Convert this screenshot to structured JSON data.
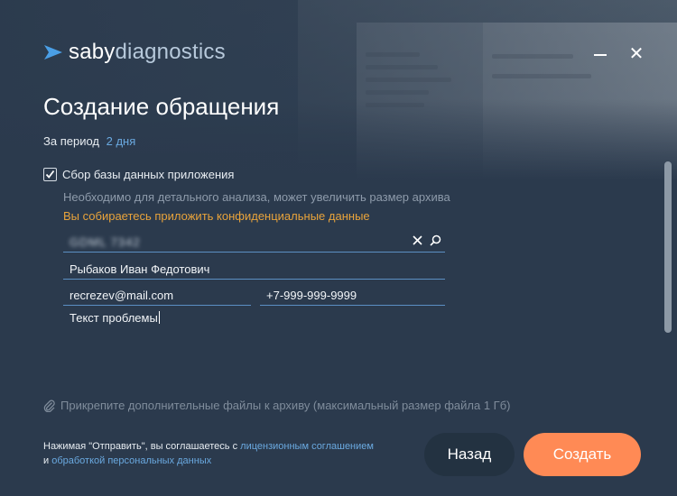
{
  "window": {
    "minimize_label": "minimize",
    "close_label": "✕"
  },
  "logo": {
    "part1": "saby",
    "part2": "diagnostics"
  },
  "title": "Создание обращения",
  "period": {
    "label": "За период",
    "value": "2 дня"
  },
  "collect_db": {
    "checked": true,
    "label": "Сбор базы данных приложения",
    "hint": "Необходимо для детального анализа, может увеличить размер архива",
    "warning": "Вы собираетесь приложить конфиденциальные данные"
  },
  "form": {
    "search_value": "GDML 7342",
    "name_value": "Рыбаков Иван Федотович",
    "email_value": "recrezev@mail.com",
    "phone_value": "+7-999-999-9999",
    "problem_value": "Текст проблемы"
  },
  "attach": {
    "label": "Прикрепите дополнительные файлы к архиву (максимальный размер файла 1 Гб)"
  },
  "agreement": {
    "prefix": "Нажимая \"Отправить\", вы соглашаетесь с ",
    "license_link": "лицензионным соглашением",
    "and": "и ",
    "personal_link": "обработкой персональных данных"
  },
  "buttons": {
    "back": "Назад",
    "create": "Создать"
  },
  "colors": {
    "accent_link": "#6aa9e0",
    "warning": "#e8a33b",
    "primary_button": "#ff8a55",
    "background": "#2b3a4d"
  }
}
